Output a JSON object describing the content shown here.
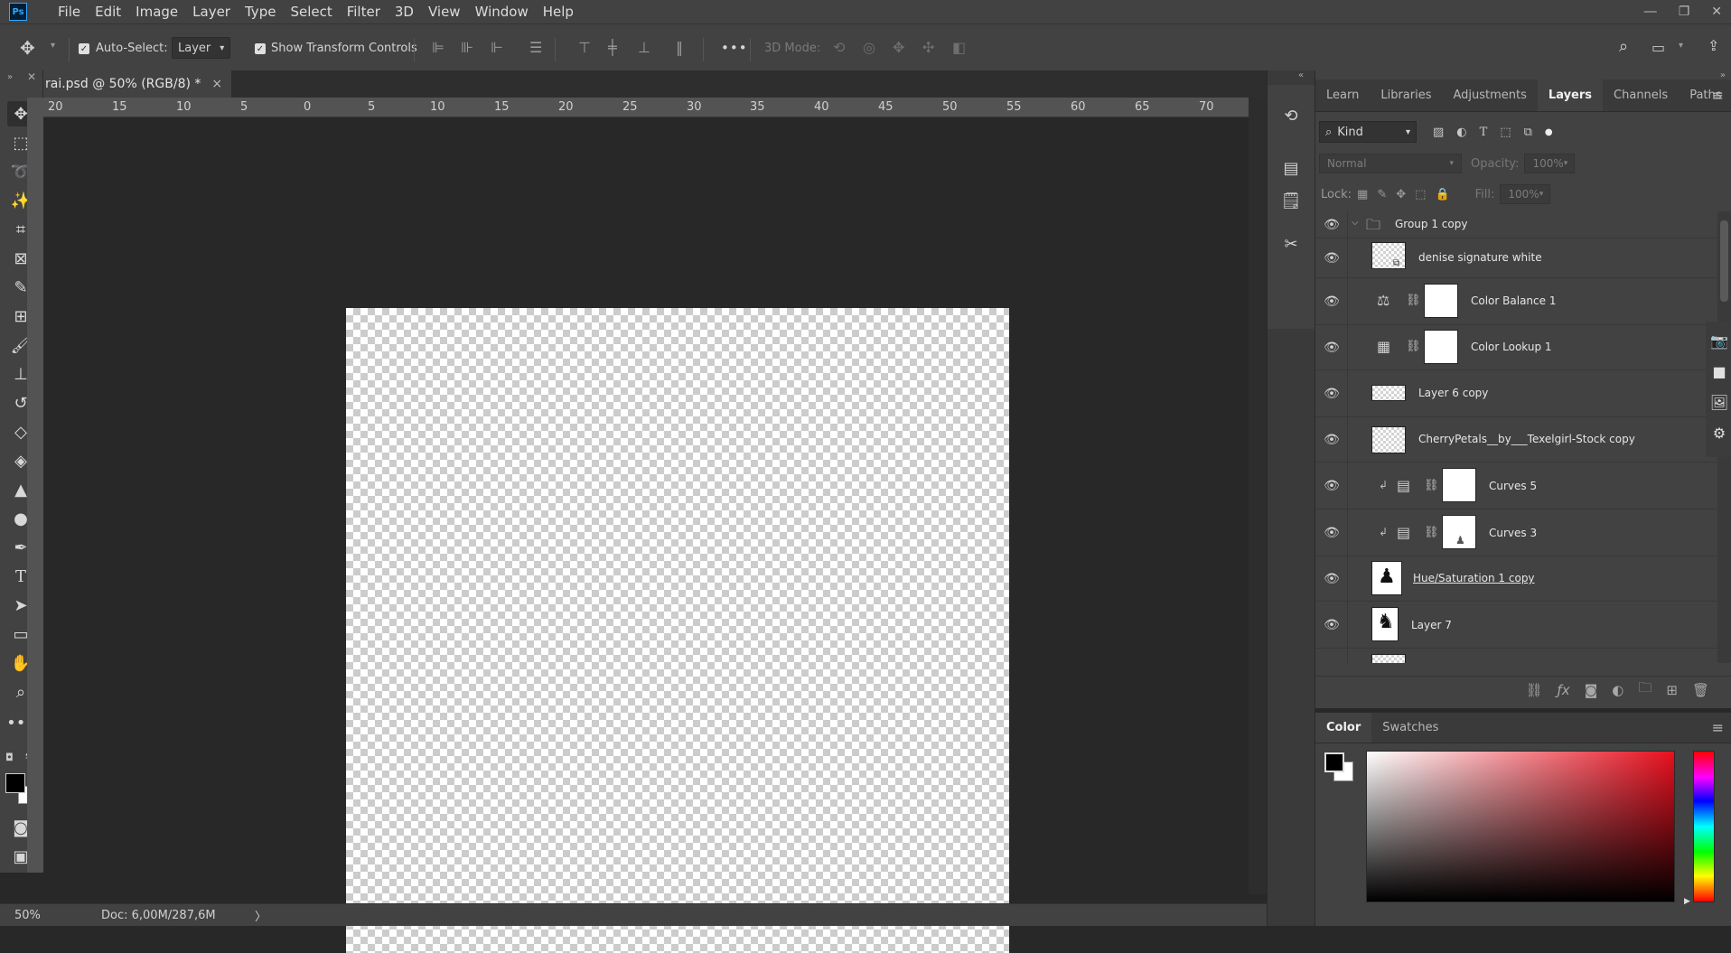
{
  "menu": {
    "logo": "Ps",
    "items": [
      "File",
      "Edit",
      "Image",
      "Layer",
      "Type",
      "Select",
      "Filter",
      "3D",
      "View",
      "Window",
      "Help"
    ]
  },
  "options": {
    "auto_select_label": "Auto-Select:",
    "auto_select_value": "Layer",
    "transform_label": "Show Transform Controls",
    "more_label": "•••",
    "mode_3d_label": "3D Mode:"
  },
  "document": {
    "tab_title": "rai.psd @ 50% (RGB/8) *",
    "close": "×",
    "ruler_ticks": [
      "20",
      "15",
      "10",
      "5",
      "0",
      "5",
      "10",
      "15",
      "20",
      "25",
      "30",
      "35",
      "40",
      "45",
      "50",
      "55",
      "60",
      "65",
      "70"
    ]
  },
  "status": {
    "zoom": "50%",
    "doc": "Doc: 6,00M/287,6M",
    "arrow": "〉"
  },
  "layers_panel": {
    "tabs": [
      "Learn",
      "Libraries",
      "Adjustments",
      "Layers",
      "Channels",
      "Paths"
    ],
    "active_tab": "Layers",
    "kind": "Kind",
    "blend_mode": "Normal",
    "opacity_label": "Opacity:",
    "opacity_value": "100%",
    "lock_label": "Lock:",
    "fill_label": "Fill:",
    "fill_value": "100%",
    "layers": [
      {
        "name": "Group 1 copy",
        "type": "group"
      },
      {
        "name": "denise signature white",
        "type": "smart"
      },
      {
        "name": "Color Balance 1",
        "type": "adjustment",
        "icon": "color-balance-icon"
      },
      {
        "name": "Color Lookup 1",
        "type": "adjustment",
        "icon": "color-lookup-icon"
      },
      {
        "name": "Layer 6 copy",
        "type": "pixel"
      },
      {
        "name": "CherryPetals__by___Texelgirl-Stock copy",
        "type": "pixel"
      },
      {
        "name": "Curves 5",
        "type": "curves-clipped"
      },
      {
        "name": "Curves 3",
        "type": "curves-clipped"
      },
      {
        "name": "Hue/Saturation 1 copy",
        "type": "pixel"
      },
      {
        "name": "Layer 7",
        "type": "pixel"
      }
    ]
  },
  "color_panel": {
    "tabs": [
      "Color",
      "Swatches"
    ],
    "active_tab": "Color",
    "fg": "#000000",
    "bg": "#ffffff",
    "hue": "#e8101f"
  }
}
